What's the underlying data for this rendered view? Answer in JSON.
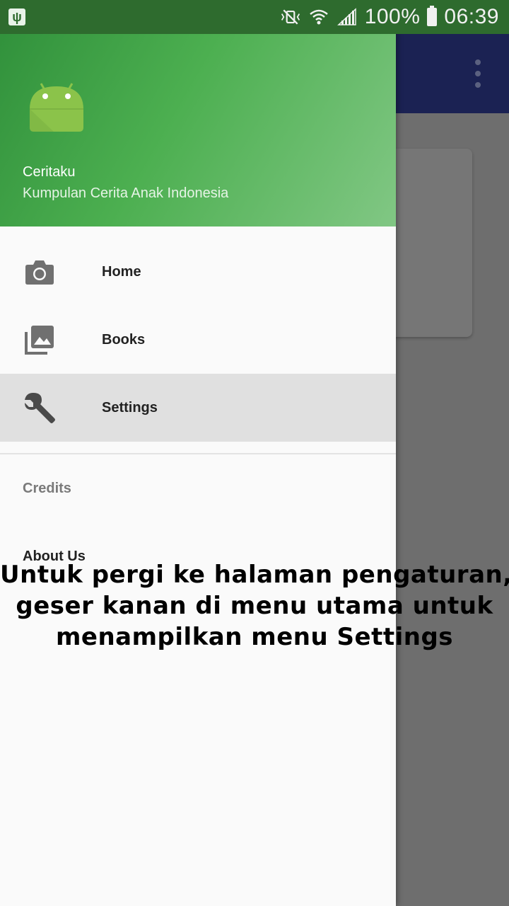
{
  "status_bar": {
    "battery_percent": "100%",
    "time": "06:39"
  },
  "drawer": {
    "header": {
      "app_name": "Ceritaku",
      "subtitle": "Kumpulan Cerita Anak Indonesia"
    },
    "items": [
      {
        "label": "Home",
        "icon": "camera-icon"
      },
      {
        "label": "Books",
        "icon": "photo-library-icon"
      },
      {
        "label": "Settings",
        "icon": "wrench-icon",
        "selected": true
      }
    ],
    "section_header": "Credits",
    "section_items": [
      {
        "label": "About Us"
      }
    ]
  },
  "caption": {
    "line1": "Untuk pergi ke halaman pengaturan,",
    "line2": "geser kanan di menu utama untuk",
    "line3": "menampilkan menu Settings"
  },
  "colors": {
    "header_green": "#4caf50",
    "app_bar": "#1b2253",
    "selected_bg": "#e0e0e0"
  }
}
